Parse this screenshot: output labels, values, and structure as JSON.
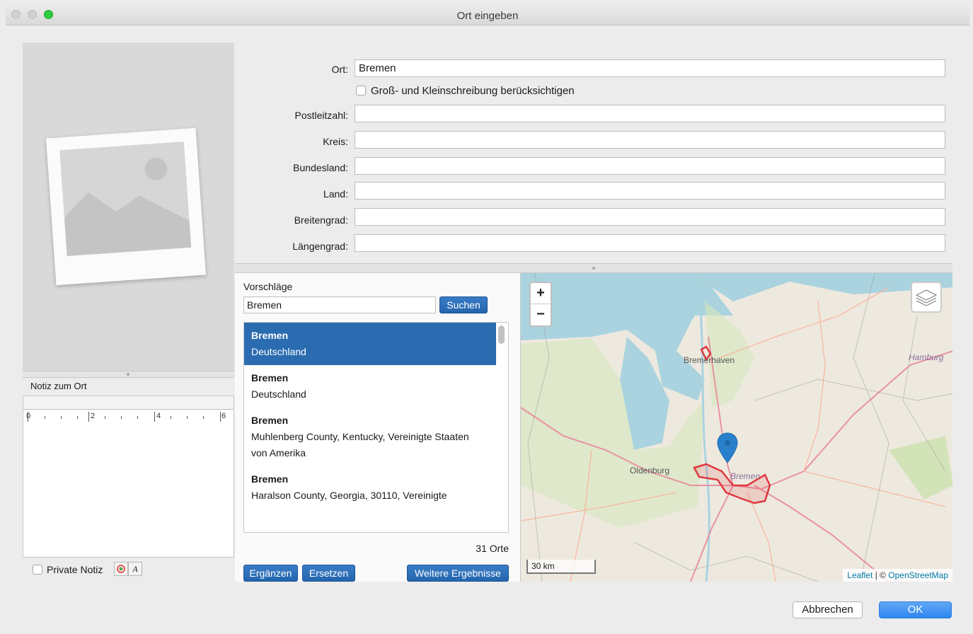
{
  "window": {
    "title": "Ort eingeben"
  },
  "note": {
    "label": "Notiz zum Ort",
    "ruler_ticks": [
      "0",
      "2",
      "4",
      "6"
    ],
    "private_label": "Private Notiz"
  },
  "form": {
    "ort_label": "Ort:",
    "ort_value": "Bremen",
    "case_label": "Groß- und Kleinschreibung berücksichtigen",
    "plz_label": "Postleitzahl:",
    "plz_value": "",
    "kreis_label": "Kreis:",
    "kreis_value": "",
    "bundesland_label": "Bundesland:",
    "bundesland_value": "",
    "land_label": "Land:",
    "land_value": "",
    "breitengrad_label": "Breitengrad:",
    "breitengrad_value": "",
    "laengengrad_label": "Längengrad:",
    "laengengrad_value": ""
  },
  "suggestions": {
    "heading": "Vorschläge",
    "search_value": "Bremen",
    "search_button": "Suchen",
    "items": [
      {
        "name": "Bremen",
        "detail": "Deutschland",
        "selected": true
      },
      {
        "name": "Bremen",
        "detail": "Deutschland",
        "selected": false
      },
      {
        "name": "Bremen",
        "detail": "Muhlenberg County, Kentucky, Vereinigte Staaten",
        "detail2": "von Amerika",
        "selected": false
      },
      {
        "name": "Bremen",
        "detail": "Haralson County, Georgia, 30110, Vereinigte",
        "selected": false
      }
    ],
    "count": "31 Orte",
    "btn_add": "Ergänzen",
    "btn_replace": "Ersetzen",
    "btn_more": "Weitere Ergebnisse"
  },
  "map": {
    "zoom_in": "+",
    "zoom_out": "−",
    "labels": {
      "bremerhaven": "Bremerhaven",
      "hamburg": "Hamburg",
      "oldenburg": "Oldenburg",
      "bremen": "Bremen"
    },
    "scale": "30 km",
    "attribution_leaflet": "Leaflet",
    "attribution_sep": " | © ",
    "attribution_osm": "OpenStreetMap",
    "colors": {
      "water": "#aad3df",
      "land": "#eee9df",
      "green": "#d6e7bd",
      "motorway": "#e892a2",
      "boundary": "#e0393e",
      "marker": "#2a81cb"
    }
  },
  "footer": {
    "cancel": "Abbrechen",
    "ok": "OK"
  }
}
